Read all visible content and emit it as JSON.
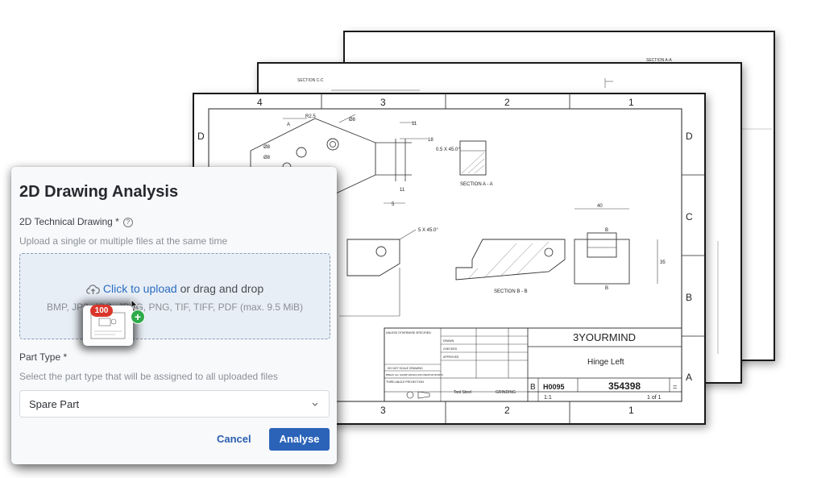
{
  "dialog": {
    "title": "2D Drawing Analysis",
    "drawing_field": {
      "label": "2D Technical Drawing *",
      "hint": "Upload a single or multiple files at the same time"
    },
    "dropzone": {
      "link_text": "Click to upload",
      "rest_text": " or drag and drop",
      "formats": "BMP, JP2, JPG, JPEG, PNG, TIF, TIFF, PDF (max. 9.5 MiB)"
    },
    "drag_badge_count": "100",
    "part_type": {
      "label": "Part Type *",
      "hint": "Select the part type that will be assigned to all uploaded files",
      "selected": "Spare Part"
    },
    "buttons": {
      "cancel": "Cancel",
      "analyse": "Analyse"
    }
  },
  "drawing": {
    "back_section": "SECTION A-A",
    "mid_section": "SECTION C-C",
    "zone_cols": [
      "4",
      "3",
      "2",
      "1"
    ],
    "bottom_cols": [
      "3",
      "2",
      "1"
    ],
    "zone_rows": [
      "D",
      "C",
      "B",
      "A"
    ],
    "company": "3YOURMIND",
    "part_name": "Hinge Left",
    "size": "B",
    "cage": "H0095",
    "dwg_no": "354398",
    "rev": "=",
    "scale": "1:1",
    "sheet": "1 of 1",
    "material": "Tool Steel",
    "finish": "GRINDING",
    "section_a": "SECTION A - A",
    "section_b": "SECTION B - B",
    "chamfer1": "0.5 X 45.0°",
    "chamfer2": "5 X 45.0°",
    "r25": "R2.5",
    "d8": "Ø8",
    "dim40": "40",
    "dim35": "35",
    "dim11": "11",
    "dim18": "18",
    "dim5": "5",
    "notes": [
      "UNLESS OTHERWISE SPECIFIED:",
      "DRAWN",
      "CHECKED",
      "APPROVED",
      "DO NOT SCALE DRAWING",
      "BREAK ALL SHARP EDGES AND REMOVE BURRS",
      "THIRD ANGLE PROJECTION"
    ]
  }
}
